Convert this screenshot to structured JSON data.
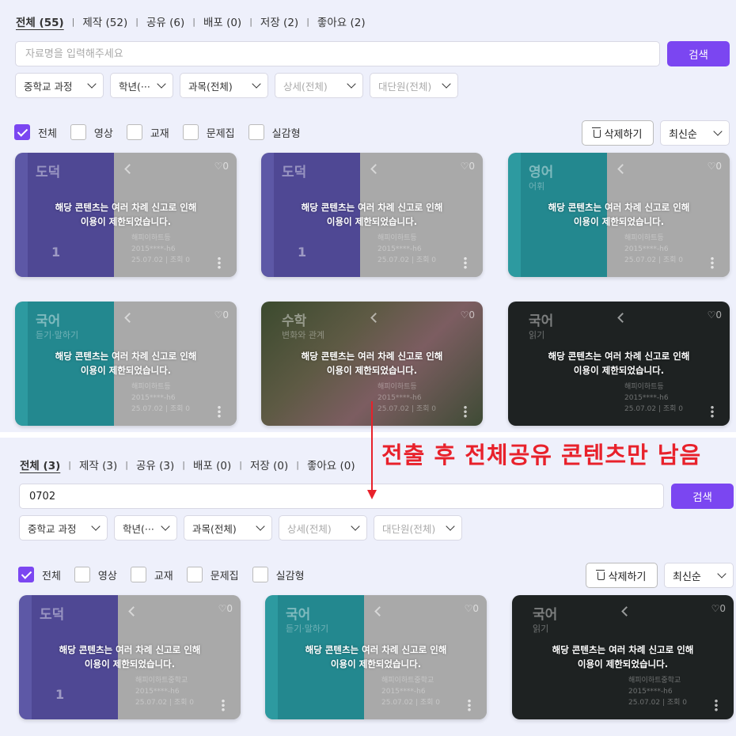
{
  "top": {
    "tabs": [
      {
        "label": "전체 (55)",
        "active": true
      },
      {
        "label": "제작 (52)"
      },
      {
        "label": "공유 (6)"
      },
      {
        "label": "배포 (0)"
      },
      {
        "label": "저장 (2)"
      },
      {
        "label": "좋아요 (2)"
      }
    ],
    "search": {
      "value": "",
      "placeholder": "자료명을 입력해주세요",
      "button": "검색"
    },
    "filters": [
      "중학교 과정",
      "학년(···",
      "과목(전체)",
      "상세(전체)",
      "대단원(전체)"
    ],
    "checkboxes": [
      {
        "label": "전체",
        "checked": true
      },
      {
        "label": "영상",
        "checked": false
      },
      {
        "label": "교재",
        "checked": false
      },
      {
        "label": "문제집",
        "checked": false
      },
      {
        "label": "실감형",
        "checked": false
      }
    ],
    "delete_label": "삭제하기",
    "sort": "최신순",
    "cards": [
      {
        "subject": "도덕",
        "sub": "",
        "style": "purple",
        "likes": "0",
        "number": "1",
        "meta": [
          "해피이하트등",
          "2015****-h6",
          "25.07.02 | 조회 0"
        ],
        "message1": "해당 콘텐츠는 여러 차례 신고로 인해",
        "message2": "이용이 제한되었습니다."
      },
      {
        "subject": "도덕",
        "sub": "",
        "style": "purple",
        "likes": "0",
        "number": "1",
        "meta": [
          "해피이하트등",
          "2015****-h6",
          "25.07.02 | 조회 0"
        ],
        "message1": "해당 콘텐츠는 여러 차례 신고로 인해",
        "message2": "이용이 제한되었습니다."
      },
      {
        "subject": "영어",
        "sub": "어휘",
        "style": "teal",
        "likes": "0",
        "number": "",
        "meta": [
          "해피이하트등",
          "2015****-h6",
          "25.07.02 | 조회 0"
        ],
        "message1": "해당 콘텐츠는 여러 차례 신고로 인해",
        "message2": "이용이 제한되었습니다."
      },
      {
        "subject": "국어",
        "sub": "듣기·말하기",
        "style": "teal",
        "likes": "0",
        "number": "",
        "meta": [
          "해피이하트등",
          "2015****-h6",
          "25.07.02 | 조회 0"
        ],
        "message1": "해당 콘텐츠는 여러 차례 신고로 인해",
        "message2": "이용이 제한되었습니다."
      },
      {
        "subject": "수학",
        "sub": "변화와 관계",
        "style": "photo",
        "likes": "0",
        "number": "",
        "meta": [
          "해피이하트등",
          "2015****-h6",
          "25.07.02 | 조회 0"
        ],
        "message1": "해당 콘텐츠는 여러 차례 신고로 인해",
        "message2": "이용이 제한되었습니다."
      },
      {
        "subject": "국어",
        "sub": "읽기",
        "style": "dark",
        "likes": "0",
        "number": "",
        "meta": [
          "해피이하트등",
          "2015****-h6",
          "25.07.02 | 조회 0"
        ],
        "message1": "해당 콘텐츠는 여러 차례 신고로 인해",
        "message2": "이용이 제한되었습니다."
      }
    ]
  },
  "bottom": {
    "tabs": [
      {
        "label": "전체 (3)",
        "active": true
      },
      {
        "label": "제작 (3)"
      },
      {
        "label": "공유 (3)"
      },
      {
        "label": "배포 (0)"
      },
      {
        "label": "저장 (0)"
      },
      {
        "label": "좋아요 (0)"
      }
    ],
    "search": {
      "value": "0702",
      "placeholder": "자료명을 입력해주세요",
      "button": "검색"
    },
    "filters": [
      "중학교 과정",
      "학년(···",
      "과목(전체)",
      "상세(전체)",
      "대단원(전체)"
    ],
    "checkboxes": [
      {
        "label": "전체",
        "checked": true
      },
      {
        "label": "영상",
        "checked": false
      },
      {
        "label": "교재",
        "checked": false
      },
      {
        "label": "문제집",
        "checked": false
      },
      {
        "label": "실감형",
        "checked": false
      }
    ],
    "delete_label": "삭제하기",
    "sort": "최신순",
    "cards": [
      {
        "subject": "도덕",
        "sub": "",
        "style": "purple",
        "likes": "0",
        "number": "1",
        "meta": [
          "해피이하트중학교",
          "2015****-h6",
          "25.07.02 | 조회 0"
        ],
        "message1": "해당 콘텐츠는 여러 차례 신고로 인해",
        "message2": "이용이 제한되었습니다."
      },
      {
        "subject": "국어",
        "sub": "듣기·말하기",
        "style": "teal",
        "likes": "0",
        "number": "",
        "meta": [
          "해피이하트중학교",
          "2015****-h6",
          "25.07.02 | 조회 0"
        ],
        "message1": "해당 콘텐츠는 여러 차례 신고로 인해",
        "message2": "이용이 제한되었습니다."
      },
      {
        "subject": "국어",
        "sub": "읽기",
        "style": "dark",
        "likes": "0",
        "number": "",
        "meta": [
          "해피이하트중학교",
          "2015****-h6",
          "25.07.02 | 조회 0"
        ],
        "message1": "해당 콘텐츠는 여러 차례 신고로 인해",
        "message2": "이용이 제한되었습니다."
      }
    ]
  },
  "annotation": {
    "text": "전출 후 전체공유 콘텐츠만 남음",
    "color": "#e8212b"
  },
  "colors": {
    "accent": "#7b46f1",
    "background": "#eef0fb"
  }
}
